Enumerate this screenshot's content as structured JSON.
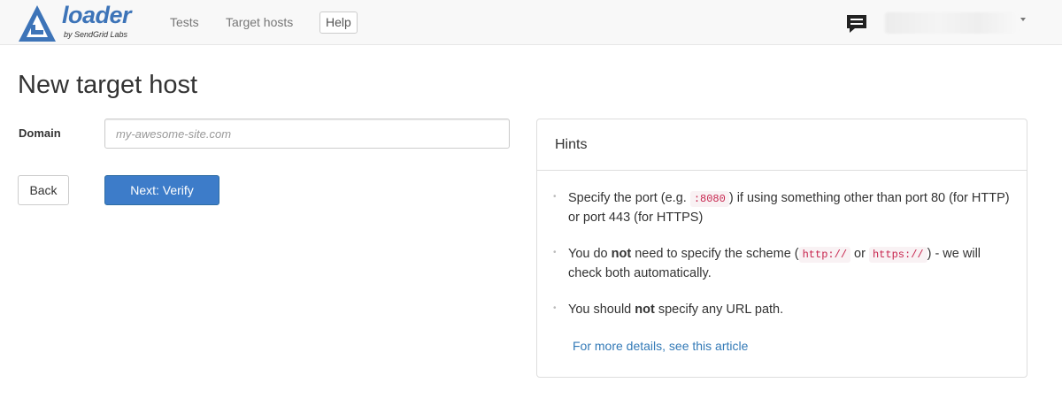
{
  "brand": {
    "name": "loader",
    "subtitle": "by SendGrid Labs",
    "color": "#3d74b8"
  },
  "nav": {
    "tests": "Tests",
    "target_hosts": "Target hosts",
    "help": "Help"
  },
  "page": {
    "title": "New target host"
  },
  "form": {
    "domain_label": "Domain",
    "domain_placeholder": "my-awesome-site.com",
    "back_label": "Back",
    "next_label": "Next: Verify"
  },
  "hints": {
    "title": "Hints",
    "item1": {
      "pre": "Specify the port (e.g. ",
      "code": ":8080",
      "post": ") if using something other than port 80 (for HTTP) or port 443 (for HTTPS)"
    },
    "item2": {
      "pre": "You do ",
      "bold": "not",
      "mid": " need to specify the scheme (",
      "code1": "http://",
      "or": " or ",
      "code2": "https://",
      "post": ") - we will check both automatically."
    },
    "item3": {
      "pre": "You should ",
      "bold": "not",
      "post": " specify any URL path."
    },
    "more_link": "For more details, see this article"
  },
  "icons": {
    "logo": "loader-logo-icon",
    "chat": "chat-bubble-icon",
    "caret": "caret-down-icon"
  },
  "colors": {
    "primary": "#3d7cc9",
    "link": "#337ab7",
    "code": "#c7254e"
  }
}
